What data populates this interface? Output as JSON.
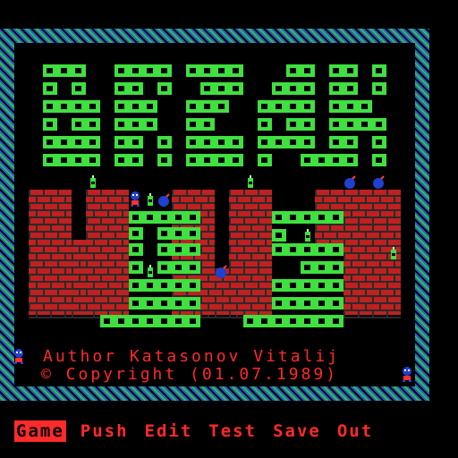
{
  "colors": {
    "green": "#3fe03f",
    "red_brick": "#c02020",
    "mortar": "#5a1010",
    "text_red": "#ff2a2a",
    "blue": "#2040d0"
  },
  "credits": {
    "author": "Author Katasonov Vitalij",
    "copyright": "© Copyright (01.07.1989)"
  },
  "menu": {
    "items": [
      {
        "label": "Game",
        "active": true
      },
      {
        "label": "Push",
        "active": false
      },
      {
        "label": "Edit",
        "active": false
      },
      {
        "label": "Test",
        "active": false
      },
      {
        "label": "Save",
        "active": false
      },
      {
        "label": "Out",
        "active": false
      }
    ]
  },
  "icons": [
    "bottle-icon",
    "bomb-icon",
    "robot-icon",
    "player-icon"
  ]
}
